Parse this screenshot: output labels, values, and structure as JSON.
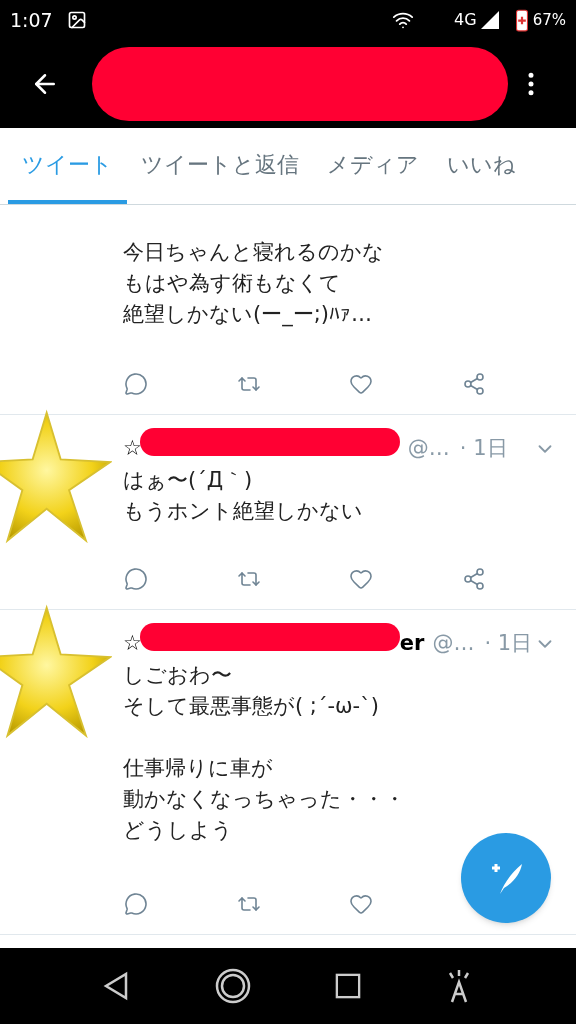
{
  "status_bar": {
    "time": "1:07",
    "network": "4G",
    "battery": "67%"
  },
  "toolbar": {
    "title_redacted": true
  },
  "tabs": [
    {
      "label": "ツイート",
      "selected": true
    },
    {
      "label": "ツイートと返信",
      "selected": false
    },
    {
      "label": "メディア",
      "selected": false
    },
    {
      "label": "いいね",
      "selected": false
    }
  ],
  "tweets": [
    {
      "paragraphs": [
        [
          "今日ちゃんと寝れるのかな",
          "もはや為す術もなくて",
          "絶望しかない(ー_ー;)ﾊｧ…"
        ]
      ]
    },
    {
      "header": {
        "name_start": "☆",
        "handle": "@…",
        "time": "· 1日"
      },
      "sticker": true,
      "paragraphs": [
        [
          "はぁ〜(´Д｀)",
          "もうホント絶望しかない"
        ]
      ]
    },
    {
      "header": {
        "name_start": "☆",
        "name_end": "er",
        "handle": "@…",
        "time": "· 1日"
      },
      "sticker": true,
      "paragraphs": [
        [
          "しごおわ〜",
          "そして最悪事態が( ;´-ω-`)"
        ],
        [
          "仕事帰りに車が",
          "動かなくなっちゃった・・・",
          "どうしよう"
        ]
      ]
    }
  ]
}
